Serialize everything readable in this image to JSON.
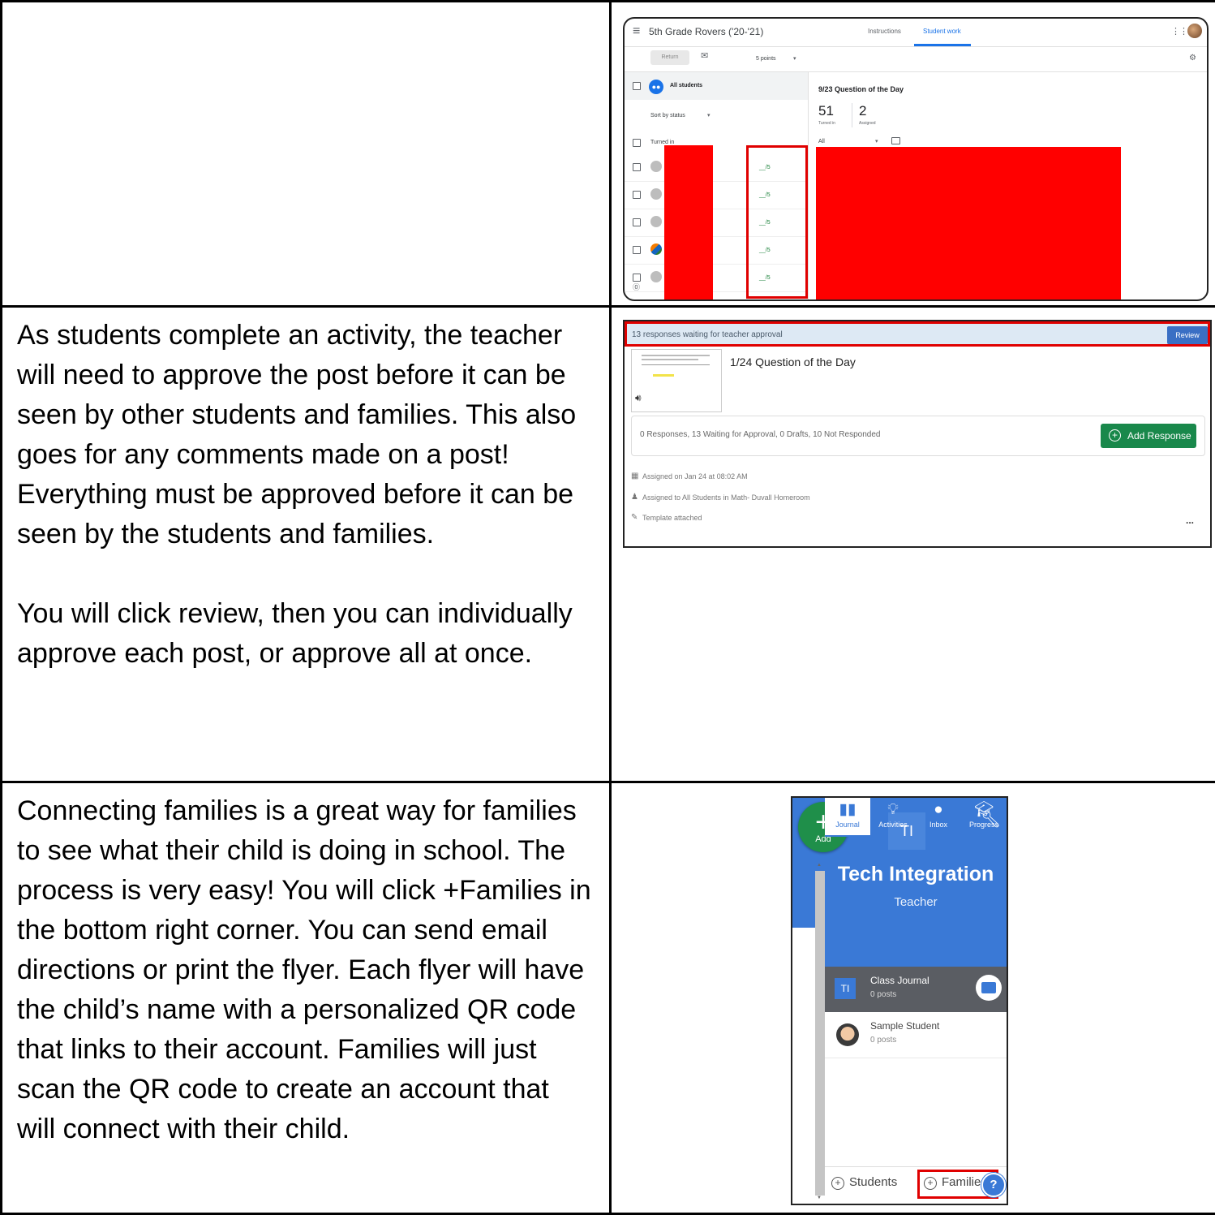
{
  "paragraphs": {
    "approval": [
      "As students complete an activity, the teacher will need to approve the post before it can be seen by other students and families. This also goes for any comments made on a post! Everything must be approved before it can be seen by the students and families.",
      "You will click review, then you can individually approve each post, or approve all at once."
    ],
    "families": "Connecting families is a great way for families to see what their child is doing in school. The process is very easy! You will click +Families in the bottom right corner. You can send email directions or print the flyer. Each flyer will have the child’s name with a personalized QR code that links to their account. Families will just scan the QR code to create an account that will connect with their child."
  },
  "classroom": {
    "class_name": "5th Grade Rovers ('20-'21)",
    "tabs": [
      "Instructions",
      "Student work"
    ],
    "active_tab": "Student work",
    "return_label": "Return",
    "points": "5 points",
    "all_students": "All students",
    "sort": "Sort by status",
    "turned_in_header": "Turned in",
    "grades": [
      "__/5",
      "__/5",
      "__/5",
      "__/5",
      "__/5"
    ],
    "assignment_title": "9/23 Question of the Day",
    "turned_in_count": "51",
    "turned_in_label": "Turned in",
    "assigned_count": "2",
    "assigned_label": "Assigned",
    "filter": "All"
  },
  "approval": {
    "banner_text": "13 responses waiting for teacher approval",
    "review_label": "Review",
    "activity_title": "1/24 Question of the Day",
    "responses_summary": "0 Responses, 13 Waiting for Approval, 0 Drafts, 10 Not Responded",
    "add_response_label": "Add Response",
    "assigned_on": "Assigned on Jan 24 at 08:02 AM",
    "assigned_to": "Assigned to All Students in Math- Duvall Homeroom",
    "template": "Template attached",
    "more": "..."
  },
  "seesaw": {
    "add_label": "Add",
    "initials": "TI",
    "name": "Tech Integration",
    "role": "Teacher",
    "tabs": [
      "Journal",
      "Activities",
      "Inbox",
      "Progress"
    ],
    "active_tab": "Journal",
    "class_journal": {
      "name": "Class Journal",
      "posts": "0 posts",
      "initials": "TI"
    },
    "student": {
      "name": "Sample Student",
      "posts": "0 posts"
    },
    "students_button": "Students",
    "families_button": "Families",
    "help": "?"
  },
  "colors": {
    "redaction": "#ff0000",
    "highlight_box": "#e00000",
    "classroom_accent": "#1a73e8",
    "seesaw_blue": "#3a79d6",
    "seesaw_green": "#1f8f4a",
    "add_response_green": "#19884b"
  }
}
